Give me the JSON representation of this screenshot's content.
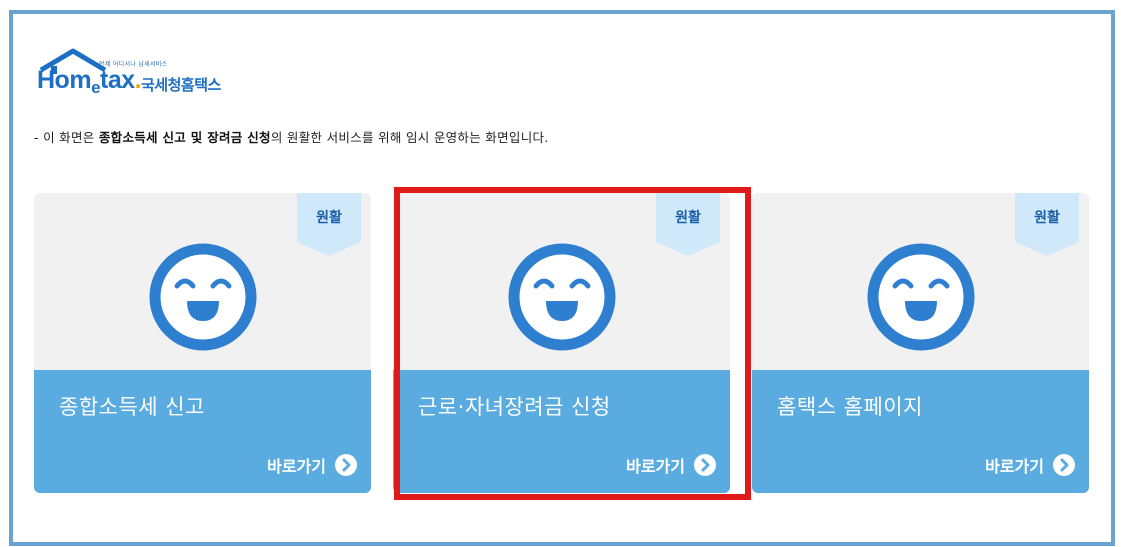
{
  "logo": {
    "tagline": "언제 어디서나 납세서비스",
    "word_prefix": "Hom",
    "word_e": "e",
    "word_suffix": "tax",
    "word_dot": ".",
    "korean": "국세청홈택스"
  },
  "notice": {
    "prefix": "- 이 화면은 ",
    "bold1": "종합소득세 신고 및 장려금 신청",
    "suffix": "의 원활한 서비스를 위해 임시 운영하는 화면입니다."
  },
  "cards": [
    {
      "status": "원활",
      "title": "종합소득세 신고",
      "go_label": "바로가기"
    },
    {
      "status": "원활",
      "title": "근로·자녀장려금 신청",
      "go_label": "바로가기"
    },
    {
      "status": "원활",
      "title": "홈택스 홈페이지",
      "go_label": "바로가기"
    }
  ],
  "colors": {
    "frame_border": "#6aa3cf",
    "card_bottom": "#5aace0",
    "card_top": "#f1f1f1",
    "badge_bg": "#cfe8fa",
    "face_blue": "#2e7fd0",
    "highlight": "#e01a1a"
  }
}
